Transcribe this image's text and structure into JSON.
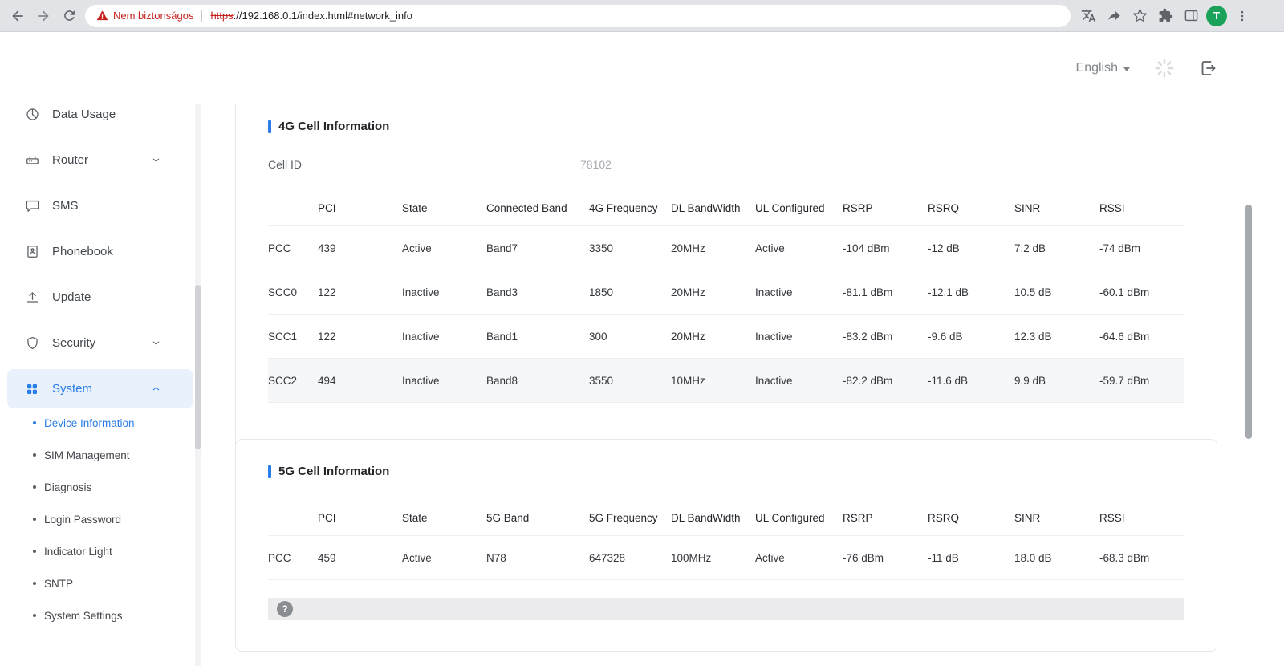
{
  "browser": {
    "security_warning": "Nem biztonságos",
    "url_https": "https",
    "url_rest": "://192.168.0.1/index.html#network_info",
    "avatar_letter": "T"
  },
  "header": {
    "language": "English"
  },
  "sidebar": {
    "items": [
      {
        "label": "Data Usage"
      },
      {
        "label": "Router"
      },
      {
        "label": "SMS"
      },
      {
        "label": "Phonebook"
      },
      {
        "label": "Update"
      },
      {
        "label": "Security"
      },
      {
        "label": "System"
      }
    ],
    "subitems": [
      {
        "label": "Device Information"
      },
      {
        "label": "SIM Management"
      },
      {
        "label": "Diagnosis"
      },
      {
        "label": "Login Password"
      },
      {
        "label": "Indicator Light"
      },
      {
        "label": "SNTP"
      },
      {
        "label": "System Settings"
      }
    ]
  },
  "cell4g": {
    "title": "4G Cell Information",
    "cell_id_label": "Cell ID",
    "cell_id_value": "78102",
    "columns": [
      "",
      "PCI",
      "State",
      "Connected Band",
      "4G Frequency",
      "DL BandWidth",
      "UL Configured",
      "RSRP",
      "RSRQ",
      "SINR",
      "RSSI"
    ],
    "rows": [
      [
        "PCC",
        "439",
        "Active",
        "Band7",
        "3350",
        "20MHz",
        "Active",
        "-104 dBm",
        "-12 dB",
        "7.2 dB",
        "-74 dBm"
      ],
      [
        "SCC0",
        "122",
        "Inactive",
        "Band3",
        "1850",
        "20MHz",
        "Inactive",
        "-81.1 dBm",
        "-12.1 dB",
        "10.5 dB",
        "-60.1 dBm"
      ],
      [
        "SCC1",
        "122",
        "Inactive",
        "Band1",
        "300",
        "20MHz",
        "Inactive",
        "-83.2 dBm",
        "-9.6 dB",
        "12.3 dB",
        "-64.6 dBm"
      ],
      [
        "SCC2",
        "494",
        "Inactive",
        "Band8",
        "3550",
        "10MHz",
        "Inactive",
        "-82.2 dBm",
        "-11.6 dB",
        "9.9 dB",
        "-59.7 dBm"
      ]
    ]
  },
  "cell5g": {
    "title": "5G Cell Information",
    "columns": [
      "",
      "PCI",
      "State",
      "5G Band",
      "5G Frequency",
      "DL BandWidth",
      "UL Configured",
      "RSRP",
      "RSRQ",
      "SINR",
      "RSSI"
    ],
    "rows": [
      [
        "PCC",
        "459",
        "Active",
        "N78",
        "647328",
        "100MHz",
        "Active",
        "-76 dBm",
        "-11 dB",
        "18.0 dB",
        "-68.3 dBm"
      ]
    ],
    "help_label": "?"
  },
  "colors": {
    "accent_blue": "#2a7de8",
    "warning_red": "#c5221f",
    "avatar_green": "#1aa25b"
  }
}
